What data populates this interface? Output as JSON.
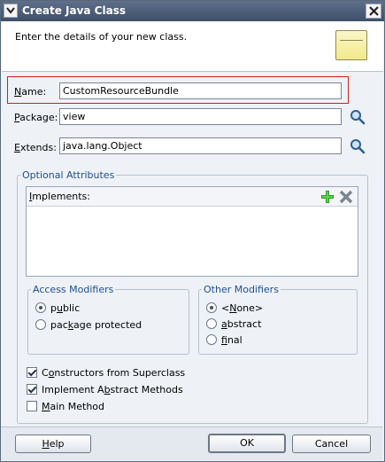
{
  "window": {
    "title": "Create Java Class"
  },
  "header": {
    "text": "Enter the details of your new class."
  },
  "form": {
    "name_label_mnemonic": "N",
    "name_label_rest": "ame:",
    "name_value": "CustomResourceBundle",
    "package_label_mnemonic": "P",
    "package_label_rest": "ackage:",
    "package_value": "view",
    "extends_label_mnemonic": "E",
    "extends_label_rest": "xtends:",
    "extends_value": "java.lang.Object"
  },
  "optional": {
    "title": "Optional Attributes",
    "implements_mnemonic": "I",
    "implements_rest": "mplements:"
  },
  "access": {
    "title": "Access Modifiers",
    "options": [
      {
        "pre": "p",
        "mn": "u",
        "post": "blic",
        "selected": true
      },
      {
        "pre": "pac",
        "mn": "k",
        "post": "age protected",
        "selected": false
      }
    ]
  },
  "other": {
    "title": "Other Modifiers",
    "options": [
      {
        "pre": "<",
        "mn": "N",
        "post": "one>",
        "selected": true
      },
      {
        "pre": "",
        "mn": "a",
        "post": "bstract",
        "selected": false
      },
      {
        "pre": "",
        "mn": "f",
        "post": "inal",
        "selected": false
      }
    ]
  },
  "checks": [
    {
      "pre": "C",
      "mn": "o",
      "post": "nstructors from Superclass",
      "checked": true
    },
    {
      "pre": "Implement A",
      "mn": "b",
      "post": "stract Methods",
      "checked": true
    },
    {
      "pre": "",
      "mn": "M",
      "post": "ain Method",
      "checked": false
    }
  ],
  "buttons": {
    "help_mn": "H",
    "help_rest": "elp",
    "ok": "OK",
    "cancel": "Cancel"
  },
  "icons": {
    "search": "search-icon",
    "add": "add-icon",
    "remove": "remove-icon"
  }
}
